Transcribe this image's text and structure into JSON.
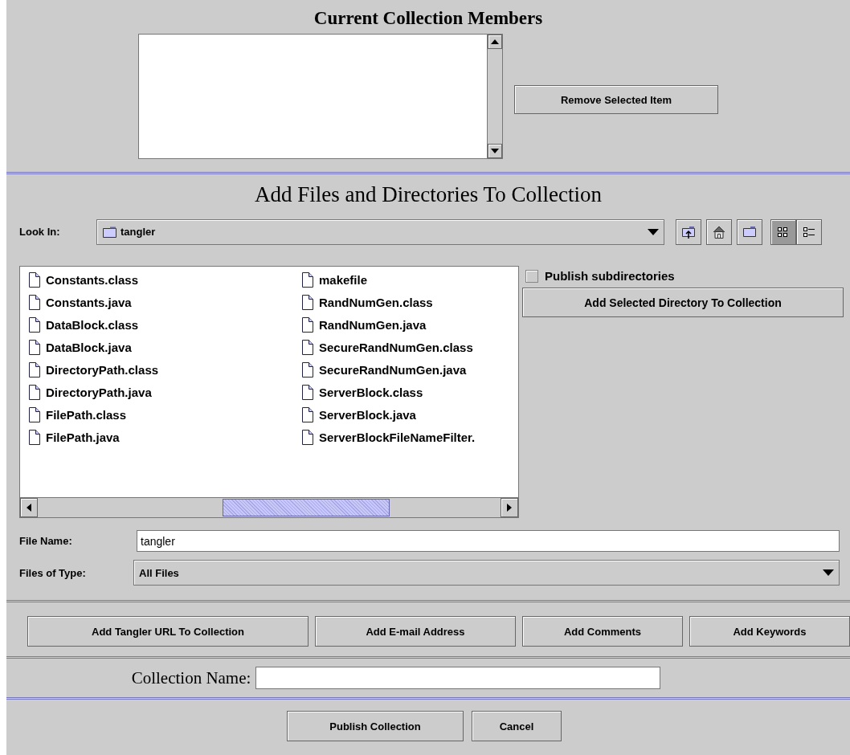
{
  "members": {
    "title": "Current Collection Members",
    "remove_button": "Remove Selected Item"
  },
  "add_files": {
    "title": "Add Files and Directories To Collection",
    "look_in": {
      "label": "Look In:",
      "value": "tangler"
    },
    "toolbar": [
      {
        "kind": "up",
        "selected": false
      },
      {
        "kind": "home",
        "selected": false
      },
      {
        "kind": "new-folder",
        "selected": false
      },
      {
        "kind": "list",
        "selected": true
      },
      {
        "kind": "details",
        "selected": false
      }
    ],
    "files": [
      "Constants.class",
      "Constants.java",
      "DataBlock.class",
      "DataBlock.java",
      "DirectoryPath.class",
      "DirectoryPath.java",
      "FilePath.class",
      "FilePath.java",
      "makefile",
      "RandNumGen.class",
      "RandNumGen.java",
      "SecureRandNumGen.class",
      "SecureRandNumGen.java",
      "ServerBlock.class",
      "ServerBlock.java",
      "ServerBlockFileNameFilter."
    ],
    "publish_subdirectories": {
      "label": "Publish subdirectories",
      "checked": false
    },
    "add_directory_button": "Add Selected Directory To Collection",
    "file_name": {
      "label": "File Name:",
      "value": "tangler"
    },
    "files_of_type": {
      "label": "Files of Type:",
      "value": "All Files"
    }
  },
  "actions": [
    "Add Tangler URL To Collection",
    "Add E-mail Address",
    "Add Comments",
    "Add Keywords"
  ],
  "collection_name": {
    "label": "Collection Name:"
  },
  "buttons": [
    "Publish Collection",
    "Cancel"
  ]
}
